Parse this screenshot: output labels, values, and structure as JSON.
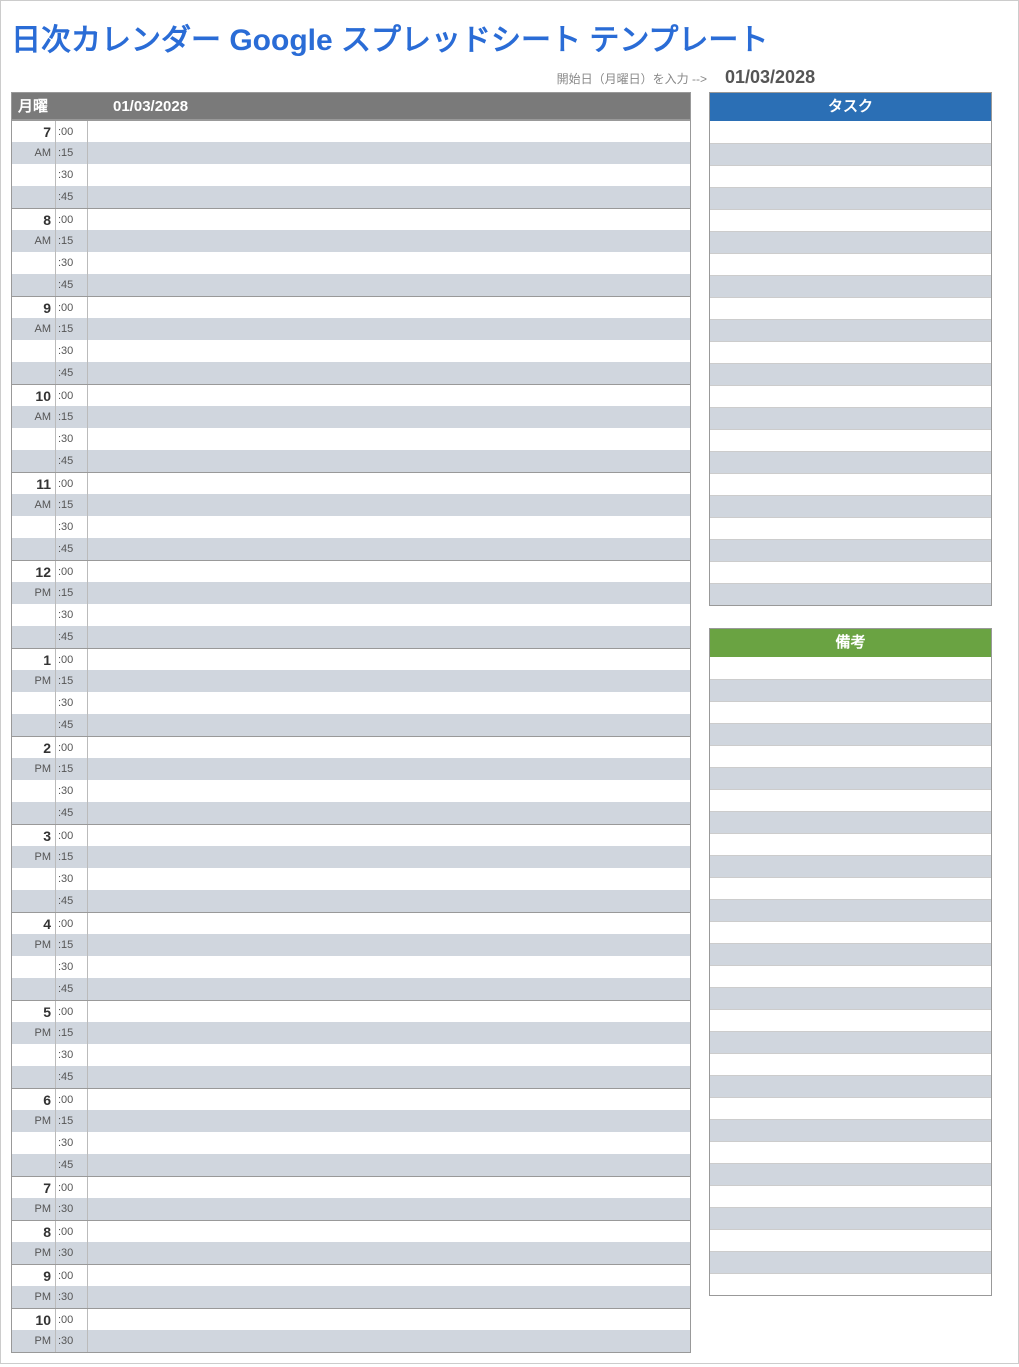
{
  "title": "日次カレンダー Google スプレッドシート テンプレート",
  "instruction": "開始日（月曜日）を入力 -->",
  "start_date": "01/03/2028",
  "day": {
    "label": "月曜",
    "date": "01/03/2028"
  },
  "schedule": [
    {
      "hour": "7",
      "ampm": "AM",
      "mins": [
        ":00",
        ":15",
        ":30",
        ":45"
      ]
    },
    {
      "hour": "8",
      "ampm": "AM",
      "mins": [
        ":00",
        ":15",
        ":30",
        ":45"
      ]
    },
    {
      "hour": "9",
      "ampm": "AM",
      "mins": [
        ":00",
        ":15",
        ":30",
        ":45"
      ]
    },
    {
      "hour": "10",
      "ampm": "AM",
      "mins": [
        ":00",
        ":15",
        ":30",
        ":45"
      ]
    },
    {
      "hour": "11",
      "ampm": "AM",
      "mins": [
        ":00",
        ":15",
        ":30",
        ":45"
      ]
    },
    {
      "hour": "12",
      "ampm": "PM",
      "mins": [
        ":00",
        ":15",
        ":30",
        ":45"
      ]
    },
    {
      "hour": "1",
      "ampm": "PM",
      "mins": [
        ":00",
        ":15",
        ":30",
        ":45"
      ]
    },
    {
      "hour": "2",
      "ampm": "PM",
      "mins": [
        ":00",
        ":15",
        ":30",
        ":45"
      ]
    },
    {
      "hour": "3",
      "ampm": "PM",
      "mins": [
        ":00",
        ":15",
        ":30",
        ":45"
      ]
    },
    {
      "hour": "4",
      "ampm": "PM",
      "mins": [
        ":00",
        ":15",
        ":30",
        ":45"
      ]
    },
    {
      "hour": "5",
      "ampm": "PM",
      "mins": [
        ":00",
        ":15",
        ":30",
        ":45"
      ]
    },
    {
      "hour": "6",
      "ampm": "PM",
      "mins": [
        ":00",
        ":15",
        ":30",
        ":45"
      ]
    },
    {
      "hour": "7",
      "ampm": "PM",
      "mins": [
        ":00",
        ":30"
      ]
    },
    {
      "hour": "8",
      "ampm": "PM",
      "mins": [
        ":00",
        ":30"
      ]
    },
    {
      "hour": "9",
      "ampm": "PM",
      "mins": [
        ":00",
        ":30"
      ]
    },
    {
      "hour": "10",
      "ampm": "PM",
      "mins": [
        ":00",
        ":30"
      ]
    }
  ],
  "tasks": {
    "header": "タスク",
    "rows": 22
  },
  "notes": {
    "header": "備考",
    "rows": 29
  }
}
